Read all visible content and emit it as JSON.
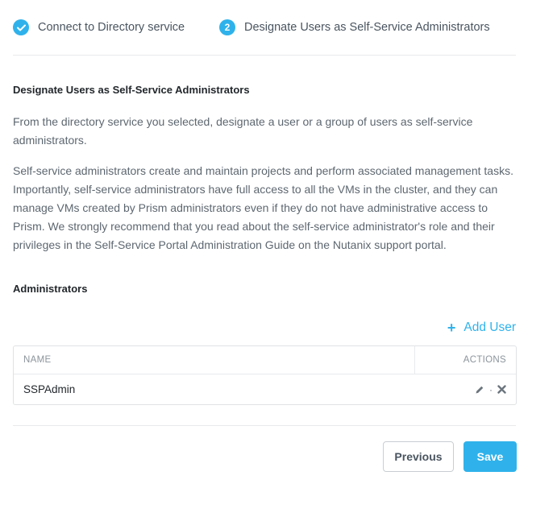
{
  "wizard": {
    "steps": [
      {
        "number": "",
        "label": "Connect to Directory service",
        "state": "completed"
      },
      {
        "number": "2",
        "label": "Designate Users as Self-Service Administrators",
        "state": "active"
      }
    ]
  },
  "section": {
    "title": "Designate Users as Self-Service Administrators",
    "paragraph1": "From the directory service you selected, designate a user or a group of users as self-service administrators.",
    "paragraph2": "Self-service administrators create and maintain projects and perform associated management tasks. Importantly, self-service administrators have full access to all the VMs in the cluster, and they can manage VMs created by Prism administrators even if they do not have administrative access to Prism. We strongly recommend that you read about the self-service administrator's role and their privileges in the Self-Service Portal Administration Guide on the Nutanix support portal."
  },
  "administrators": {
    "title": "Administrators",
    "add_user_label": "Add User",
    "columns": [
      "NAME",
      "ACTIONS"
    ],
    "rows": [
      {
        "name": "SSPAdmin",
        "separator": "·"
      }
    ]
  },
  "footer": {
    "previous_label": "Previous",
    "save_label": "Save"
  },
  "icons": {
    "step1": "check-icon",
    "add": "plus-icon",
    "edit": "pencil-icon",
    "delete": "close-icon"
  },
  "colors": {
    "accent": "#2fb2eb",
    "text": "#4a5560",
    "heading": "#22272b"
  }
}
